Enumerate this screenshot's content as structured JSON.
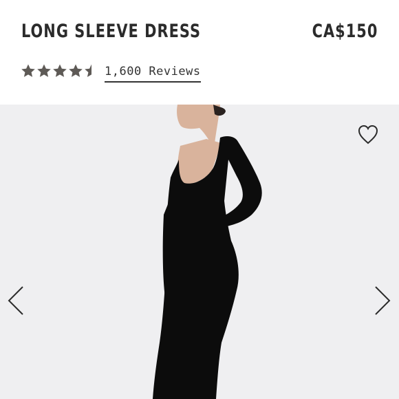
{
  "product": {
    "title": "LONG SLEEVE DRESS",
    "price": "CA$150"
  },
  "rating": {
    "value": 4.5,
    "max": 5,
    "star_color": "#5e5a56",
    "reviews_label": "1,600 Reviews"
  },
  "gallery": {
    "image": "model-wearing-black-long-sleeve-dress",
    "background_color": "#efeff1",
    "icons": {
      "favorite": "heart-icon",
      "previous": "chevron-left-icon",
      "next": "chevron-right-icon"
    }
  }
}
